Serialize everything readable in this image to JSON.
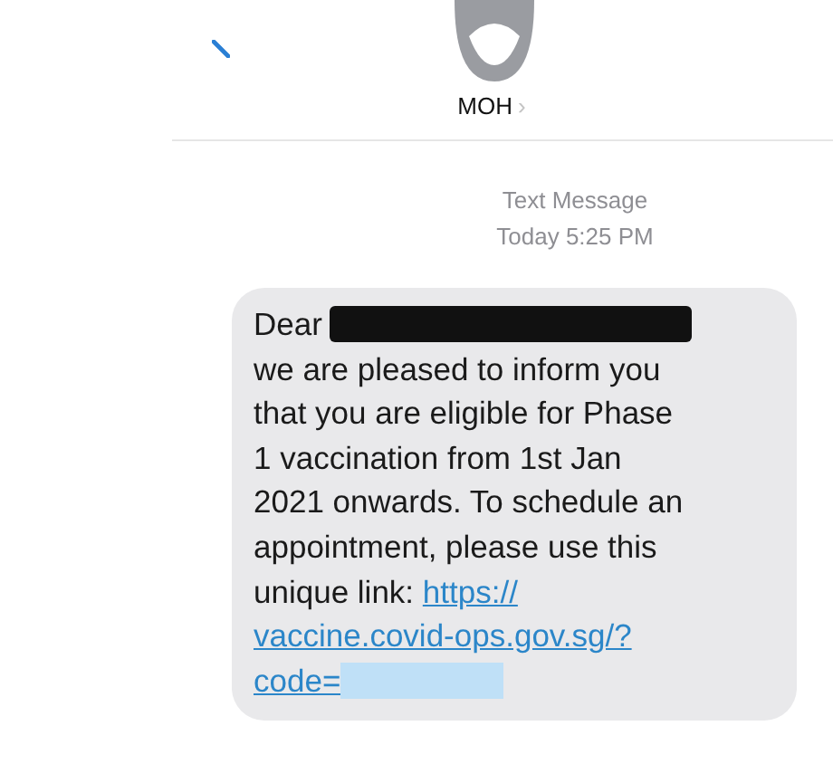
{
  "header": {
    "contact": "MOH",
    "chevron": "›"
  },
  "meta": {
    "label": "Text Message",
    "time": "Today 5:25 PM"
  },
  "message": {
    "greeting": "Dear",
    "body": "\nwe are pleased to inform you\nthat you are eligible for Phase\n1 vaccination from 1st Jan\n2021 onwards. To schedule an\nappointment, please use this\nunique link: ",
    "link_lines": [
      "https://",
      "vaccine.covid-ops.gov.sg/?",
      "code="
    ]
  }
}
